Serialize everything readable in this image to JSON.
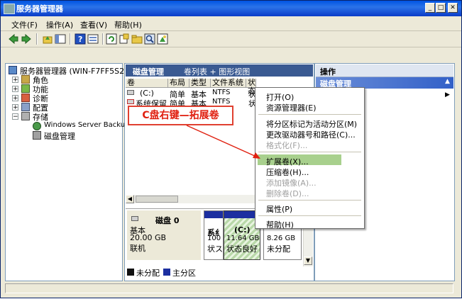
{
  "window": {
    "title": "服务器管理器"
  },
  "menu": {
    "file": "文件(F)",
    "action": "操作(A)",
    "view": "查看(V)",
    "help": "帮助(H)"
  },
  "tree": {
    "root": "服务器管理器 (WIN-F7FF5S24FL",
    "roles": "角色",
    "features": "功能",
    "diagnostics": "诊断",
    "config": "配置",
    "storage": "存储",
    "wsb": "Windows Server Backup",
    "diskmgmt": "磁盘管理"
  },
  "center": {
    "title": "磁盘管理",
    "subtitle": "卷列表 + 图形视图",
    "columns": [
      "卷",
      "布局",
      "类型",
      "文件系统",
      "状态"
    ],
    "rows": [
      {
        "vol": "(C:)",
        "layout": "简单",
        "type": "基本",
        "fs": "NTFS",
        "status": "状"
      },
      {
        "vol": "系统保留",
        "layout": "简单",
        "type": "基本",
        "fs": "NTFS",
        "status": "状"
      }
    ]
  },
  "disk": {
    "name": "磁盘 0",
    "type": "基本",
    "size": "20.00 GB",
    "state": "联机",
    "part1": {
      "l1": "系纟",
      "l2": "100",
      "l3": "状ス"
    },
    "part2": {
      "l1": "(C:)",
      "l2": "11.64 GB",
      "l3": "状态良好"
    },
    "part3": {
      "l1": "8.26 GB",
      "l2": "未分配"
    }
  },
  "legend": {
    "unalloc": "未分配",
    "primary": "主分区"
  },
  "actions": {
    "title": "操作",
    "sub": "磁盘管理"
  },
  "context_menu": {
    "open": "打开(O)",
    "explore": "资源管理器(E)",
    "mark_active": "将分区标记为活动分区(M)",
    "change_letter": "更改驱动器号和路径(C)...",
    "format": "格式化(F)...",
    "extend": "扩展卷(X)...",
    "shrink": "压缩卷(H)...",
    "mirror": "添加镜像(A)...",
    "delete": "删除卷(D)...",
    "properties": "属性(P)",
    "help": "帮助(H)"
  },
  "annotation": {
    "text": "C盘右键—拓展卷"
  },
  "colors": {
    "accent": "#e02010",
    "primary_partition": "#1c2fa0",
    "highlight": "#a8d08d"
  }
}
